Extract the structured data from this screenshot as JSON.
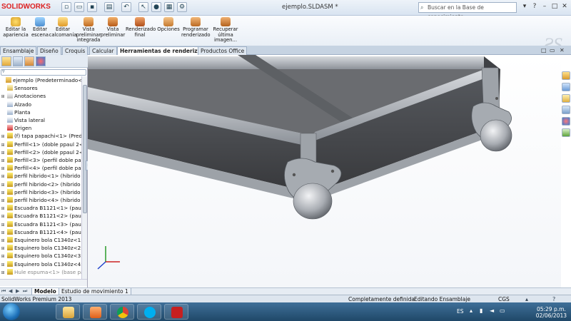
{
  "app": {
    "logo_text": "SOLIDWORKS",
    "document_title": "ejemplo.SLDASM *",
    "search_placeholder": "Buscar en la Base de conocimiento"
  },
  "ribbon": {
    "buttons": [
      {
        "label": "Editar la apariencia",
        "icon": "appearance-icon"
      },
      {
        "label": "Editar escena",
        "icon": "scene-icon"
      },
      {
        "label": "Editar calcomanía",
        "icon": "decal-icon"
      },
      {
        "label": "Vista preliminar integrada",
        "icon": "integrated-preview-icon"
      },
      {
        "label": "Vista preliminar",
        "icon": "preview-window-icon"
      },
      {
        "label": "Renderizado final",
        "icon": "final-render-icon"
      },
      {
        "label": "Opciones",
        "icon": "options-icon"
      },
      {
        "label": "Programar renderizado",
        "icon": "schedule-render-icon"
      },
      {
        "label": "Recuperar última imagen...",
        "icon": "recall-image-icon"
      }
    ]
  },
  "command_tabs": [
    "Ensamblaje",
    "Diseño",
    "Croquis",
    "Calcular",
    "Herramientas de renderizado",
    "Productos Office"
  ],
  "active_command_tab": "Herramientas de renderizado",
  "tree": {
    "items": [
      {
        "label": "ejemplo  (Predeterminado<Es",
        "icon": "assembly-icon"
      },
      {
        "label": "Sensores",
        "icon": "sensors-icon"
      },
      {
        "label": "Anotaciones",
        "icon": "annotations-icon"
      },
      {
        "label": "Alzado",
        "icon": "plane-icon"
      },
      {
        "label": "Planta",
        "icon": "plane-icon"
      },
      {
        "label": "Vista lateral",
        "icon": "plane-icon"
      },
      {
        "label": "Origen",
        "icon": "origin-icon"
      },
      {
        "label": "(f) tapa papachi<1> (Pred",
        "icon": "part-icon"
      },
      {
        "label": "Perfill<1> (doble ppaul 2<",
        "icon": "part-icon"
      },
      {
        "label": "Perfill<2> (doble ppaul 2<",
        "icon": "part-icon"
      },
      {
        "label": "Perfill<3> (perfil doble pa",
        "icon": "part-icon"
      },
      {
        "label": "Perfill<4> (perfil doble pa",
        "icon": "part-icon"
      },
      {
        "label": "perfil hibrido<1> (hibrido",
        "icon": "part-icon"
      },
      {
        "label": "perfil hibrido<2> (hibrido",
        "icon": "part-icon"
      },
      {
        "label": "perfil hibrido<3> (hibrido",
        "icon": "part-icon"
      },
      {
        "label": "perfil hibrido<4> (hibrido",
        "icon": "part-icon"
      },
      {
        "label": "Escuadra B1121<1> (paul-",
        "icon": "part-icon"
      },
      {
        "label": "Escuadra B1121<2> (paul-",
        "icon": "part-icon"
      },
      {
        "label": "Escuadra B1121<3> (paul-",
        "icon": "part-icon"
      },
      {
        "label": "Escuadra B1121<4> (paul-",
        "icon": "part-icon"
      },
      {
        "label": "Esquinero bola C1340z<1>",
        "icon": "part-icon"
      },
      {
        "label": "Esquinero bola C1340z<2>",
        "icon": "part-icon"
      },
      {
        "label": "Esquinero bola C1340z<3>",
        "icon": "part-icon"
      },
      {
        "label": "Esquinero bola C1340z<4>",
        "icon": "part-icon"
      },
      {
        "label": "Hule espuma<1> (base pa",
        "icon": "part-icon"
      }
    ]
  },
  "bottom_tabs": [
    "Modelo",
    "Estudio de movimiento 1"
  ],
  "active_bottom_tab": "Modelo",
  "status": {
    "product": "SolidWorks Premium 2013",
    "definition": "Completamente definida",
    "mode": "Editando Ensamblaje",
    "units": "CGS"
  },
  "taskbar": {
    "language": "ES",
    "time": "05:29 p.m.",
    "date": "02/06/2013",
    "apps": [
      "windows-explorer-icon",
      "media-player-icon",
      "chrome-icon",
      "skype-icon",
      "solidworks-icon"
    ]
  },
  "colors": {
    "accent_red": "#d22222",
    "titlebar": "#dde6f1",
    "model_metal": "#a8adb4",
    "model_panel": "#4a4c50"
  }
}
